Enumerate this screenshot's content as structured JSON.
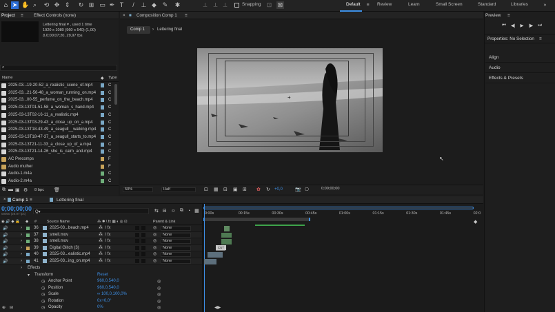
{
  "toolbar": {
    "snapping_label": "Snapping",
    "workspaces": [
      "Default",
      "Review",
      "Learn",
      "Small Screen",
      "Standard",
      "Libraries"
    ],
    "active_workspace": "Default"
  },
  "project_panel": {
    "tab_label": "Project",
    "effect_controls_tab": "Effect Controls (none)",
    "selected_item_name": "Lettering final ▾ , used 1 time",
    "selected_item_size": "1920 x 1080  (960 x 540) (1,00)",
    "selected_item_duration": "Δ 0;00;07;20, 29,97 fps",
    "search_placeholder": "⌕",
    "col_name": "Name",
    "col_type": "Type",
    "items": [
      {
        "name": "2025-03...19-20-52_a_realistic_scene_of.mp4",
        "type": "C",
        "color": "#7aa8c6"
      },
      {
        "name": "2025-03...21-56-48_a_woman_running_on.mp4",
        "type": "C",
        "color": "#7aa8c6"
      },
      {
        "name": "2025-03...00-55_perfume_on_the_beach.mp4",
        "type": "C",
        "color": "#7aa8c6"
      },
      {
        "name": "2025-03-13T01-51-58_a_woman_s_hand.mp4",
        "type": "C",
        "color": "#7aa8c6"
      },
      {
        "name": "2025-03-13T02-16-11_a_realistic.mp4",
        "type": "C",
        "color": "#7aa8c6"
      },
      {
        "name": "2025-03-13T03-29-43_a_close_up_on_a.mp4",
        "type": "C",
        "color": "#7aa8c6"
      },
      {
        "name": "2025-03-13T18-43-49_a_seagull__walking.mp4",
        "type": "C",
        "color": "#7aa8c6"
      },
      {
        "name": "2025-03-13T18-47-37_a_seagull_starts_to.mp4",
        "type": "C",
        "color": "#7aa8c6"
      },
      {
        "name": "2025-03-13T21-11-33_a_close_up_of_a.mp4",
        "type": "C",
        "color": "#7aa8c6"
      },
      {
        "name": "2025-03-13T21-14-26_she_is_calm_and.mp4",
        "type": "C",
        "color": "#7aa8c6"
      },
      {
        "name": "AC Precomps",
        "type": "F",
        "color": "#c8a35a"
      },
      {
        "name": "Audio mulher",
        "type": "F",
        "color": "#c8a35a"
      },
      {
        "name": "Audio-1.m4a",
        "type": "C",
        "color": "#6fae7a"
      },
      {
        "name": "Audio-2.m4a",
        "type": "C",
        "color": "#6fae7a"
      }
    ],
    "bpc_label": "8 bpc"
  },
  "composition_panel": {
    "tab_label": "Composition Comp 1",
    "breadcrumb_active": "Comp 1",
    "breadcrumb_other": "Lettering final",
    "zoom": "50%",
    "resolution": "Half",
    "exposure": "+0,0",
    "timecode": "0;00;00;00"
  },
  "right_panel": {
    "preview_label": "Preview",
    "properties_label": "Properties: No Selection",
    "sections": [
      "Align",
      "Audio",
      "Effects & Presets"
    ]
  },
  "timeline": {
    "tabs": [
      "Comp 1",
      "Lettering final"
    ],
    "current_time": "0;00;00;00",
    "fps_note": "00000 (29.97 fps)",
    "search_placeholder": "Q▾",
    "col_source": "Source Name",
    "col_parent": "Parent & Link",
    "ruler_ticks": [
      "0:00s",
      "00:15s",
      "00:30s",
      "00:45s",
      "01:00s",
      "01:15s",
      "01:30s",
      "01:45s",
      "02:0"
    ],
    "layers": [
      {
        "num": "36",
        "name": "2025-03...beach.mp4",
        "parent": "None",
        "color": "#6fae7a"
      },
      {
        "num": "37",
        "name": "smell.mov",
        "parent": "None",
        "color": "#6fae7a"
      },
      {
        "num": "38",
        "name": "smell.mov",
        "parent": "None",
        "color": "#6fae7a"
      },
      {
        "num": "39",
        "name": "Digital Glitch (3)",
        "parent": "None",
        "color": "#c8a35a"
      },
      {
        "num": "40",
        "name": "2025-03...ealistic.mp4",
        "parent": "None",
        "color": "#7aa8c6"
      },
      {
        "num": "41",
        "name": "2025-03...ing_on.mp4",
        "parent": "None",
        "color": "#7aa8c6"
      }
    ],
    "effects_label": "Effects",
    "transform_label": "Transform",
    "reset_label": "Reset",
    "properties": [
      {
        "name": "Anchor Point",
        "value": "960,0,540,0"
      },
      {
        "name": "Position",
        "value": "960,0,540,0"
      },
      {
        "name": "Scale",
        "value": "∞ 100,0,100,0%"
      },
      {
        "name": "Rotation",
        "value": "0x+0,0°"
      },
      {
        "name": "Opacity",
        "value": "0%"
      }
    ],
    "cut_label": "CUT"
  }
}
